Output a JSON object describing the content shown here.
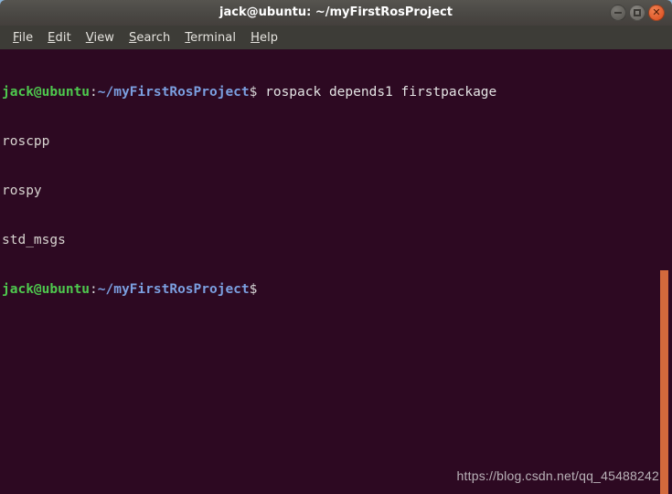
{
  "window": {
    "title": "jack@ubuntu: ~/myFirstRosProject",
    "controls": {
      "minimize": "−",
      "maximize": "□",
      "close": "✕"
    }
  },
  "menubar": {
    "items": [
      {
        "mnemonic": "F",
        "rest": "ile"
      },
      {
        "mnemonic": "E",
        "rest": "dit"
      },
      {
        "mnemonic": "V",
        "rest": "iew"
      },
      {
        "mnemonic": "S",
        "rest": "earch"
      },
      {
        "mnemonic": "T",
        "rest": "erminal"
      },
      {
        "mnemonic": "H",
        "rest": "elp"
      }
    ]
  },
  "terminal": {
    "user_host": "jack@ubuntu",
    "colon": ":",
    "path": "~/myFirstRosProject",
    "dollar": "$",
    "command": " rospack depends1 firstpackage",
    "output": [
      "roscpp",
      "rospy",
      "std_msgs"
    ],
    "colors": {
      "background": "#2d0922",
      "user_host": "#4ec94e",
      "path": "#7b9fe0",
      "output": "#d8d4d0",
      "scrollbar": "#d2693c"
    }
  },
  "watermark": {
    "text": "https://blog.csdn.net/qq_45488242"
  }
}
